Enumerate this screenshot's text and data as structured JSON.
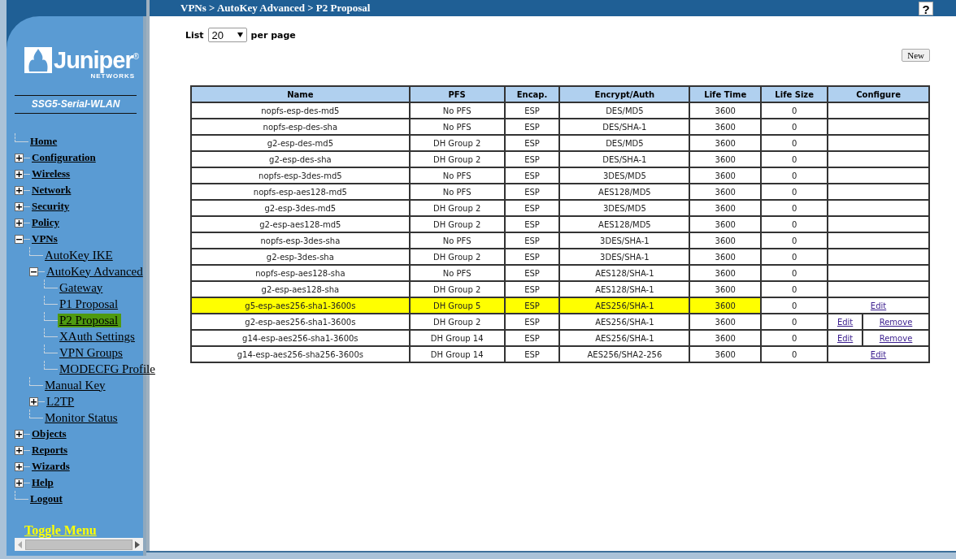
{
  "header": {
    "breadcrumb": "VPNs > AutoKey Advanced > P2 Proposal",
    "help": "?"
  },
  "sidebar": {
    "logo": {
      "name": "Juniper",
      "mark": "®",
      "tagline": "NETWORKS"
    },
    "device": "SSG5-Serial-WLAN",
    "items": [
      {
        "label": "Home",
        "kind": "leaf",
        "selected": false
      },
      {
        "label": "Configuration",
        "kind": "folder",
        "expanded": false,
        "selected": false
      },
      {
        "label": "Wireless",
        "kind": "folder",
        "expanded": false,
        "selected": false
      },
      {
        "label": "Network",
        "kind": "folder",
        "expanded": false,
        "selected": false
      },
      {
        "label": "Security",
        "kind": "folder",
        "expanded": false,
        "selected": false
      },
      {
        "label": "Policy",
        "kind": "folder",
        "expanded": false,
        "selected": false
      },
      {
        "label": "VPNs",
        "kind": "folder",
        "expanded": true,
        "selected": false,
        "children": [
          {
            "label": "AutoKey IKE",
            "kind": "leaf",
            "selected": false
          },
          {
            "label": "AutoKey Advanced",
            "kind": "folder",
            "expanded": true,
            "selected": false,
            "children": [
              {
                "label": "Gateway",
                "kind": "leaf",
                "selected": false
              },
              {
                "label": "P1 Proposal",
                "kind": "leaf",
                "selected": false
              },
              {
                "label": "P2 Proposal",
                "kind": "leaf",
                "selected": true
              },
              {
                "label": "XAuth Settings",
                "kind": "leaf",
                "selected": false
              },
              {
                "label": "VPN Groups",
                "kind": "leaf",
                "selected": false
              },
              {
                "label": "MODECFG Profile",
                "kind": "leaf",
                "selected": false
              }
            ]
          },
          {
            "label": "Manual Key",
            "kind": "leaf",
            "selected": false
          },
          {
            "label": "L2TP",
            "kind": "folder",
            "expanded": false,
            "selected": false
          },
          {
            "label": "Monitor Status",
            "kind": "leaf",
            "selected": false
          }
        ]
      },
      {
        "label": "Objects",
        "kind": "folder",
        "expanded": false,
        "selected": false
      },
      {
        "label": "Reports",
        "kind": "folder",
        "expanded": false,
        "selected": false
      },
      {
        "label": "Wizards",
        "kind": "folder",
        "expanded": false,
        "selected": false
      },
      {
        "label": "Help",
        "kind": "folder",
        "expanded": false,
        "selected": false
      },
      {
        "label": "Logout",
        "kind": "leaf",
        "selected": false
      }
    ],
    "toggle": "Toggle Menu"
  },
  "list_control": {
    "label": "List",
    "value": "20",
    "suffix": "per page"
  },
  "new_button": "New",
  "table": {
    "columns": [
      "Name",
      "PFS",
      "Encap.",
      "Encrypt/Auth",
      "Life Time",
      "Life Size",
      "Configure"
    ],
    "rows": [
      {
        "name": "nopfs-esp-des-md5",
        "pfs": "No PFS",
        "encap": "ESP",
        "encrypt_auth": "DES/MD5",
        "life_time": "3600",
        "life_size": "0",
        "highlighted": false
      },
      {
        "name": "nopfs-esp-des-sha",
        "pfs": "No PFS",
        "encap": "ESP",
        "encrypt_auth": "DES/SHA-1",
        "life_time": "3600",
        "life_size": "0",
        "highlighted": false
      },
      {
        "name": "g2-esp-des-md5",
        "pfs": "DH Group 2",
        "encap": "ESP",
        "encrypt_auth": "DES/MD5",
        "life_time": "3600",
        "life_size": "0",
        "highlighted": false
      },
      {
        "name": "g2-esp-des-sha",
        "pfs": "DH Group 2",
        "encap": "ESP",
        "encrypt_auth": "DES/SHA-1",
        "life_time": "3600",
        "life_size": "0",
        "highlighted": false
      },
      {
        "name": "nopfs-esp-3des-md5",
        "pfs": "No PFS",
        "encap": "ESP",
        "encrypt_auth": "3DES/MD5",
        "life_time": "3600",
        "life_size": "0",
        "highlighted": false
      },
      {
        "name": "nopfs-esp-aes128-md5",
        "pfs": "No PFS",
        "encap": "ESP",
        "encrypt_auth": "AES128/MD5",
        "life_time": "3600",
        "life_size": "0",
        "highlighted": false
      },
      {
        "name": "g2-esp-3des-md5",
        "pfs": "DH Group 2",
        "encap": "ESP",
        "encrypt_auth": "3DES/MD5",
        "life_time": "3600",
        "life_size": "0",
        "highlighted": false
      },
      {
        "name": "g2-esp-aes128-md5",
        "pfs": "DH Group 2",
        "encap": "ESP",
        "encrypt_auth": "AES128/MD5",
        "life_time": "3600",
        "life_size": "0",
        "highlighted": false
      },
      {
        "name": "nopfs-esp-3des-sha",
        "pfs": "No PFS",
        "encap": "ESP",
        "encrypt_auth": "3DES/SHA-1",
        "life_time": "3600",
        "life_size": "0",
        "highlighted": false
      },
      {
        "name": "g2-esp-3des-sha",
        "pfs": "DH Group 2",
        "encap": "ESP",
        "encrypt_auth": "3DES/SHA-1",
        "life_time": "3600",
        "life_size": "0",
        "highlighted": false
      },
      {
        "name": "nopfs-esp-aes128-sha",
        "pfs": "No PFS",
        "encap": "ESP",
        "encrypt_auth": "AES128/SHA-1",
        "life_time": "3600",
        "life_size": "0",
        "highlighted": false
      },
      {
        "name": "g2-esp-aes128-sha",
        "pfs": "DH Group 2",
        "encap": "ESP",
        "encrypt_auth": "AES128/SHA-1",
        "life_time": "3600",
        "life_size": "0",
        "highlighted": false
      },
      {
        "name": "g5-esp-aes256-sha1-3600s",
        "pfs": "DH Group 5",
        "encap": "ESP",
        "encrypt_auth": "AES256/SHA-1",
        "life_time": "3600",
        "life_size": "0",
        "highlighted": true,
        "actions": [
          "Edit"
        ]
      },
      {
        "name": "g2-esp-aes256-sha1-3600s",
        "pfs": "DH Group 2",
        "encap": "ESP",
        "encrypt_auth": "AES256/SHA-1",
        "life_time": "3600",
        "life_size": "0",
        "highlighted": false,
        "actions": [
          "Edit",
          "Remove"
        ]
      },
      {
        "name": "g14-esp-aes256-sha1-3600s",
        "pfs": "DH Group 14",
        "encap": "ESP",
        "encrypt_auth": "AES256/SHA-1",
        "life_time": "3600",
        "life_size": "0",
        "highlighted": false,
        "actions": [
          "Edit",
          "Remove"
        ]
      },
      {
        "name": "g14-esp-aes256-sha256-3600s",
        "pfs": "DH Group 14",
        "encap": "ESP",
        "encrypt_auth": "AES256/SHA2-256",
        "life_time": "3600",
        "life_size": "0",
        "highlighted": false,
        "actions": [
          "Edit"
        ]
      }
    ]
  }
}
